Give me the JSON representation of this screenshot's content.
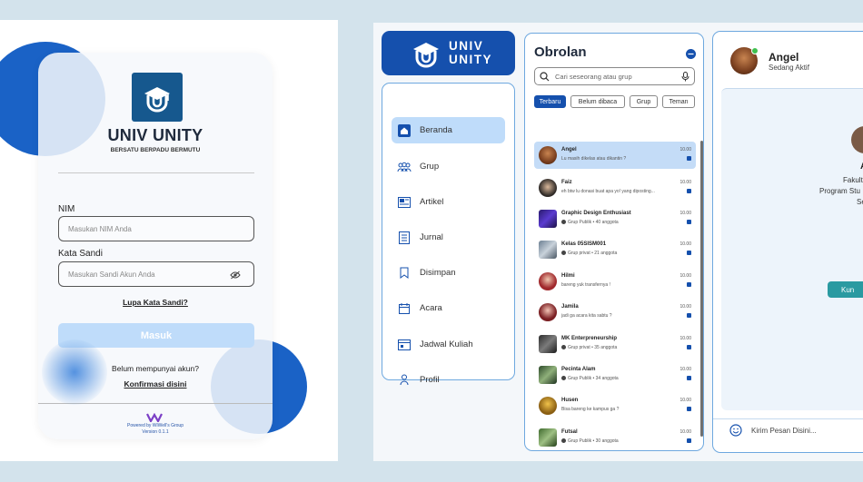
{
  "login": {
    "brand_title": "UNIV UNITY",
    "brand_subtitle": "BERSATU BERPADU BERMUTU",
    "nim_label": "NIM",
    "nim_placeholder": "Masukan NIM Anda",
    "password_label": "Kata Sandi",
    "password_placeholder": "Masukan Sandi Akun Anda",
    "forgot_password": "Lupa Kata Sandi?",
    "login_button": "Masuk",
    "no_account_text": "Belum mempunyai akun?",
    "confirm_link": "Konfirmasi disini",
    "powered_by": "Powered by WiWell's Group",
    "version": "Version 0.1.1",
    "colors": {
      "brand": "#16588e",
      "button": "#bfdcfa",
      "blob": "#1a62c6"
    }
  },
  "app": {
    "brand_line1": "UNIV",
    "brand_line2": "UNITY",
    "sidebar": [
      {
        "label": "Beranda",
        "icon": "home-icon",
        "active": true
      },
      {
        "label": "Grup",
        "icon": "group-icon",
        "active": false
      },
      {
        "label": "Artikel",
        "icon": "article-icon",
        "active": false
      },
      {
        "label": "Jurnal",
        "icon": "journal-icon",
        "active": false
      },
      {
        "label": "Disimpan",
        "icon": "bookmark-icon",
        "active": false
      },
      {
        "label": "Acara",
        "icon": "calendar-icon",
        "active": false
      },
      {
        "label": "Jadwal Kuliah",
        "icon": "schedule-icon",
        "active": false
      },
      {
        "label": "Profil",
        "icon": "profile-icon",
        "active": false
      }
    ],
    "chat": {
      "title": "Obrolan",
      "search_placeholder": "Cari seseorang atau grup",
      "filters": [
        "Terbaru",
        "Belum dibaca",
        "Grup",
        "Teman"
      ],
      "items": [
        {
          "name": "Angel",
          "preview": "Lu masih dikelas atau dikantin ?",
          "time": "10.00",
          "active": true,
          "group": false
        },
        {
          "name": "Faiz",
          "preview": "eh btw lu donasi buat apa yo! yang diposting...",
          "time": "10.00",
          "active": false,
          "group": false
        },
        {
          "name": "Graphic Design Enthusiast",
          "preview": "Grup Publik • 40 anggota",
          "time": "10.00",
          "active": false,
          "group": true
        },
        {
          "name": "Kelas 05SISM001",
          "preview": "Grup privat • 21 anggota",
          "time": "10.00",
          "active": false,
          "group": true
        },
        {
          "name": "Hilmi",
          "preview": "bareng yuk transfernya !",
          "time": "10.00",
          "active": false,
          "group": false
        },
        {
          "name": "Jamila",
          "preview": "jadi ga acara kita sabtu ?",
          "time": "10.00",
          "active": false,
          "group": false
        },
        {
          "name": "MK Enterpreneurship",
          "preview": "Grup privat • 35 anggota",
          "time": "10.00",
          "active": false,
          "group": true
        },
        {
          "name": "Pecinta Alam",
          "preview": "Grup Publik • 34 anggota",
          "time": "10.00",
          "active": false,
          "group": true
        },
        {
          "name": "Husen",
          "preview": "Bisa bareng ke kampus ga ?",
          "time": "10.00",
          "active": false,
          "group": false
        },
        {
          "name": "Futsal",
          "preview": "Grup Publik • 30 anggota",
          "time": "10.00",
          "active": false,
          "group": true
        }
      ]
    },
    "window": {
      "contact_name": "Angel",
      "contact_status": "Sedang Aktif",
      "info_letter": "A",
      "info_line1": "Fakult",
      "info_line2": "Program Stu",
      "info_line3": "Se",
      "action_label": "Kun",
      "message_placeholder": "Kirim Pesan Disini..."
    },
    "colors": {
      "primary": "#1550ad",
      "active_bg": "#bfdcfa",
      "accent": "#2a9aa1",
      "border": "#6ea8df"
    }
  }
}
